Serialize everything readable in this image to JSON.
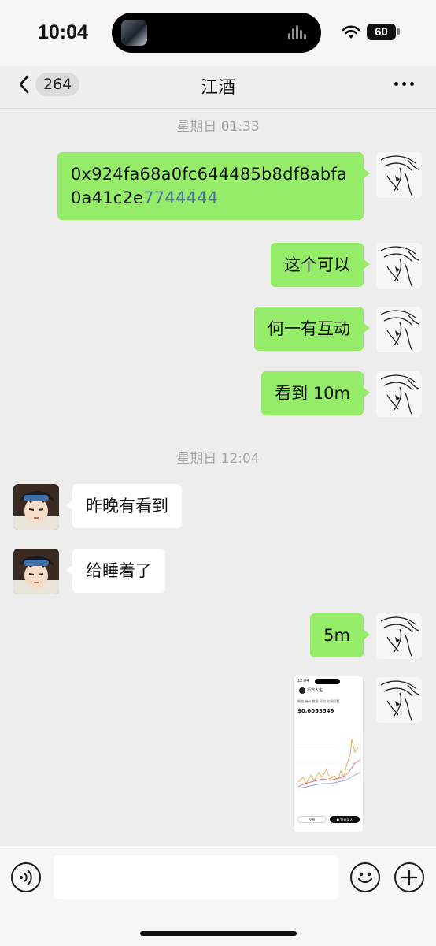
{
  "status_bar": {
    "time": "10:04",
    "battery": "60",
    "icons": [
      "now-playing-thumbnail-icon",
      "audio-wave-icon",
      "wifi-icon",
      "battery-icon"
    ]
  },
  "header": {
    "back_count": "264",
    "title": "江酒",
    "icons": [
      "back-chevron-icon",
      "more-dots-icon"
    ]
  },
  "messages": {
    "ts1": "星期日 01:33",
    "addr_part1": "0x924fa68a0fc644485b8df8abf",
    "addr_part2_plain": "a0a41c2e",
    "addr_part2_link": "7744444",
    "m2": "这个可以",
    "m3": "何一有互动",
    "m4": "看到 10m",
    "ts2": "星期日 12:04",
    "m5": "昨晚有看到",
    "m6": "给睡着了",
    "m7": "5m"
  },
  "screenshot_image": {
    "time": "12:04",
    "title": "币安人生",
    "tabs": "概览  持有  数据  风险  交易配置",
    "price": "$0.0053549",
    "btn_left": "交易",
    "btn_right": "● 快速买入"
  },
  "input_bar": {
    "icons": [
      "voice-icon",
      "emoji-icon",
      "plus-icon"
    ]
  },
  "colors": {
    "outgoing_bubble": "#95ec69",
    "incoming_bubble": "#ffffff",
    "chat_background": "#ededed",
    "link": "#4e6fa3"
  }
}
